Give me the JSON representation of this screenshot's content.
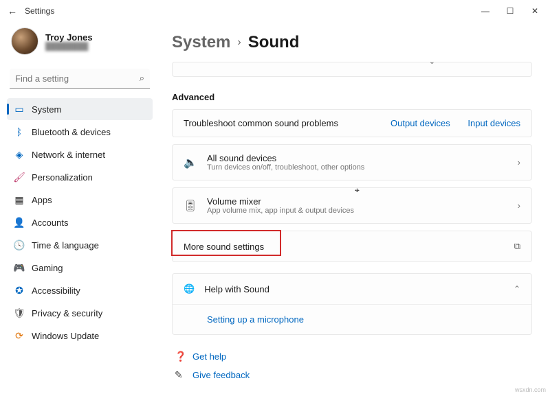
{
  "window": {
    "title": "Settings"
  },
  "user": {
    "name": "Troy Jones",
    "email": "████████"
  },
  "search": {
    "placeholder": "Find a setting"
  },
  "nav": {
    "items": [
      {
        "label": "System"
      },
      {
        "label": "Bluetooth & devices"
      },
      {
        "label": "Network & internet"
      },
      {
        "label": "Personalization"
      },
      {
        "label": "Apps"
      },
      {
        "label": "Accounts"
      },
      {
        "label": "Time & language"
      },
      {
        "label": "Gaming"
      },
      {
        "label": "Accessibility"
      },
      {
        "label": "Privacy & security"
      },
      {
        "label": "Windows Update"
      }
    ]
  },
  "breadcrumb": {
    "parent": "System",
    "current": "Sound"
  },
  "section": {
    "advanced": "Advanced"
  },
  "troubleshoot": {
    "title": "Troubleshoot common sound problems",
    "output": "Output devices",
    "input": "Input devices"
  },
  "allSound": {
    "title": "All sound devices",
    "sub": "Turn devices on/off, troubleshoot, other options"
  },
  "mixer": {
    "title": "Volume mixer",
    "sub": "App volume mix, app input & output devices"
  },
  "moreSound": {
    "title": "More sound settings"
  },
  "help": {
    "title": "Help with Sound",
    "link": "Setting up a microphone"
  },
  "footer": {
    "getHelp": "Get help",
    "feedback": "Give feedback"
  },
  "watermark": "wsxdn.com"
}
